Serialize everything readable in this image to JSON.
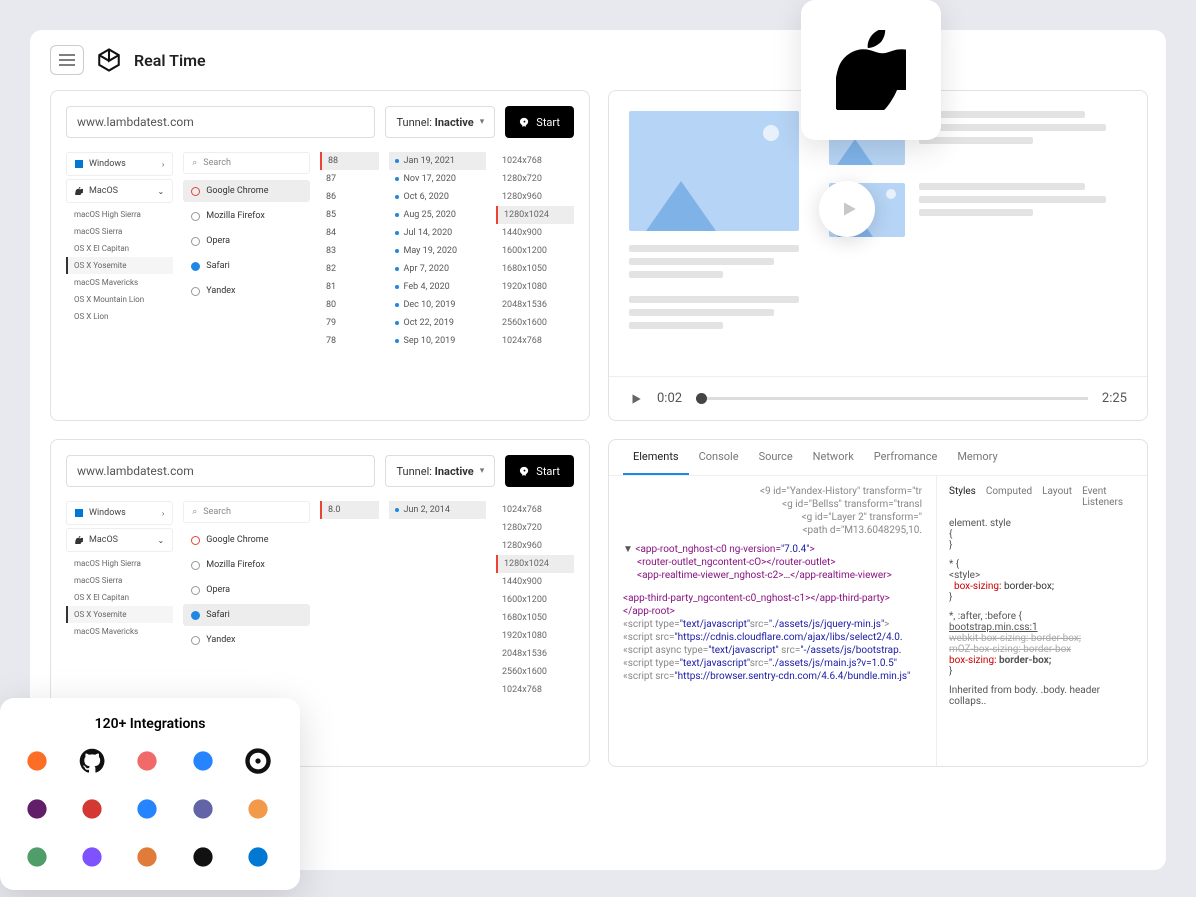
{
  "header": {
    "title": "Real Time"
  },
  "urlbar": {
    "url": "www.lambdatest.com",
    "tunnel_prefix": "Tunnel:",
    "tunnel_state": "Inactive",
    "start": "Start"
  },
  "os_panel": {
    "windows": "Windows",
    "mac": "MacOS",
    "versions": [
      "macOS High Sierra",
      "macOS Sierra",
      "OS X El Capitan",
      "OS X Yosemite",
      "macOS Mavericks",
      "OS X Mountain Lion",
      "OS X Lion"
    ],
    "active": "OS X Yosemite",
    "versions2": [
      "macOS High Sierra",
      "macOS Sierra",
      "OS X El Capitan",
      "OS X Yosemite",
      "macOS Mavericks"
    ]
  },
  "browsers": {
    "search": "Search",
    "list": [
      "Google Chrome",
      "Mozilla Firefox",
      "Opera",
      "Safari",
      "Yandex"
    ],
    "active1": "Google Chrome",
    "active2": "Safari"
  },
  "versions1": [
    "88",
    "87",
    "86",
    "85",
    "84",
    "83",
    "82",
    "81",
    "80",
    "79",
    "78"
  ],
  "versions2": [
    "8.0"
  ],
  "dates1": [
    "Jan 19, 2021",
    "Nov 17, 2020",
    "Oct 6, 2020",
    "Aug 25, 2020",
    "Jul 14, 2020",
    "May 19, 2020",
    "Apr 7, 2020",
    "Feb 4, 2020",
    "Dec 10, 2019",
    "Oct 22, 2019",
    "Sep 10, 2019"
  ],
  "dates2": [
    "Jun 2, 2014"
  ],
  "resolutions": [
    "1024x768",
    "1280x720",
    "1280x960",
    "1280x1024",
    "1440x900",
    "1600x1200",
    "1680x1050",
    "1920x1080",
    "2048x1536",
    "2560x1600",
    "1024x768"
  ],
  "active_res": "1280x1024",
  "video": {
    "current": "0:02",
    "total": "2:25"
  },
  "devtools": {
    "tabs": [
      "Elements",
      "Console",
      "Source",
      "Network",
      "Perfromance",
      "Memory"
    ],
    "subtabs": [
      "Styles",
      "Computed",
      "Layout",
      "Event Listeners"
    ],
    "snippet_top": [
      "<9 id=\"Yandex-History\" transform=\"tr",
      "  <g id=\"Bellss\" transform=\"transl",
      "    <g id=\"Layer 2\" transform=\"",
      "      <path d=\"M13.6048295,10."
    ],
    "el0": "<app-root_nghost-c0 ng-version=",
    "el0v": "\"7.0.4\"",
    "el1": "<router-outlet_ngcontent-cO></router-outlet>",
    "el2": "<app-realtime-viewer_nghost-c2>…</app-realtime-viewer>",
    "el3": "<app-third-party_ngcontent-c0_nghost-c1></app-third-party>",
    "el4": "</app-root>",
    "s1a": "«script type=",
    "s1b": "\"text/javascript\"",
    "s1c": "src=",
    "s1d": "\"./assets/js/jquery-min.js\"",
    "s2a": "«script src=",
    "s2b": "\"https://cdnis.cloudflare.com/ajax/libs/select2/4.0.",
    "s3a": "«script async type=",
    "s3b": "\"text/javascript\"",
    "s3c": " src=",
    "s3d": "\"-/assets/js/bootstrap.",
    "s4a": "«script type=",
    "s4b": "\"text/javascript\"",
    "s4c": "src=",
    "s4d": "\"./assets/js/main.js?v=1.0.5\"",
    "s5a": "«script src=",
    "s5b": "\"https://browser.sentry-cdn.com/4.6.4/bundle.min.js\"",
    "styles": {
      "es": "element. style",
      "star": "* {",
      "sty": "<style>",
      "bs": "box-sizing:",
      "bb": "border-box;",
      "sel": "*, :after, :before {",
      "src": "bootstrap.min.css:1",
      "strike1": "webkit-box-sizing: border-box;",
      "strike2": "mOZ-box-sizing: border-box",
      "inherit": "Inherited from body. .body. header collaps.."
    }
  },
  "integrations": {
    "title": "120+ Integrations",
    "names": [
      "gitlab",
      "github",
      "asana",
      "bitbucket",
      "circleci",
      "slack",
      "jenkins",
      "jira",
      "teams",
      "chat",
      "gear",
      "kotlin",
      "tools",
      "sentry",
      "azure"
    ]
  }
}
